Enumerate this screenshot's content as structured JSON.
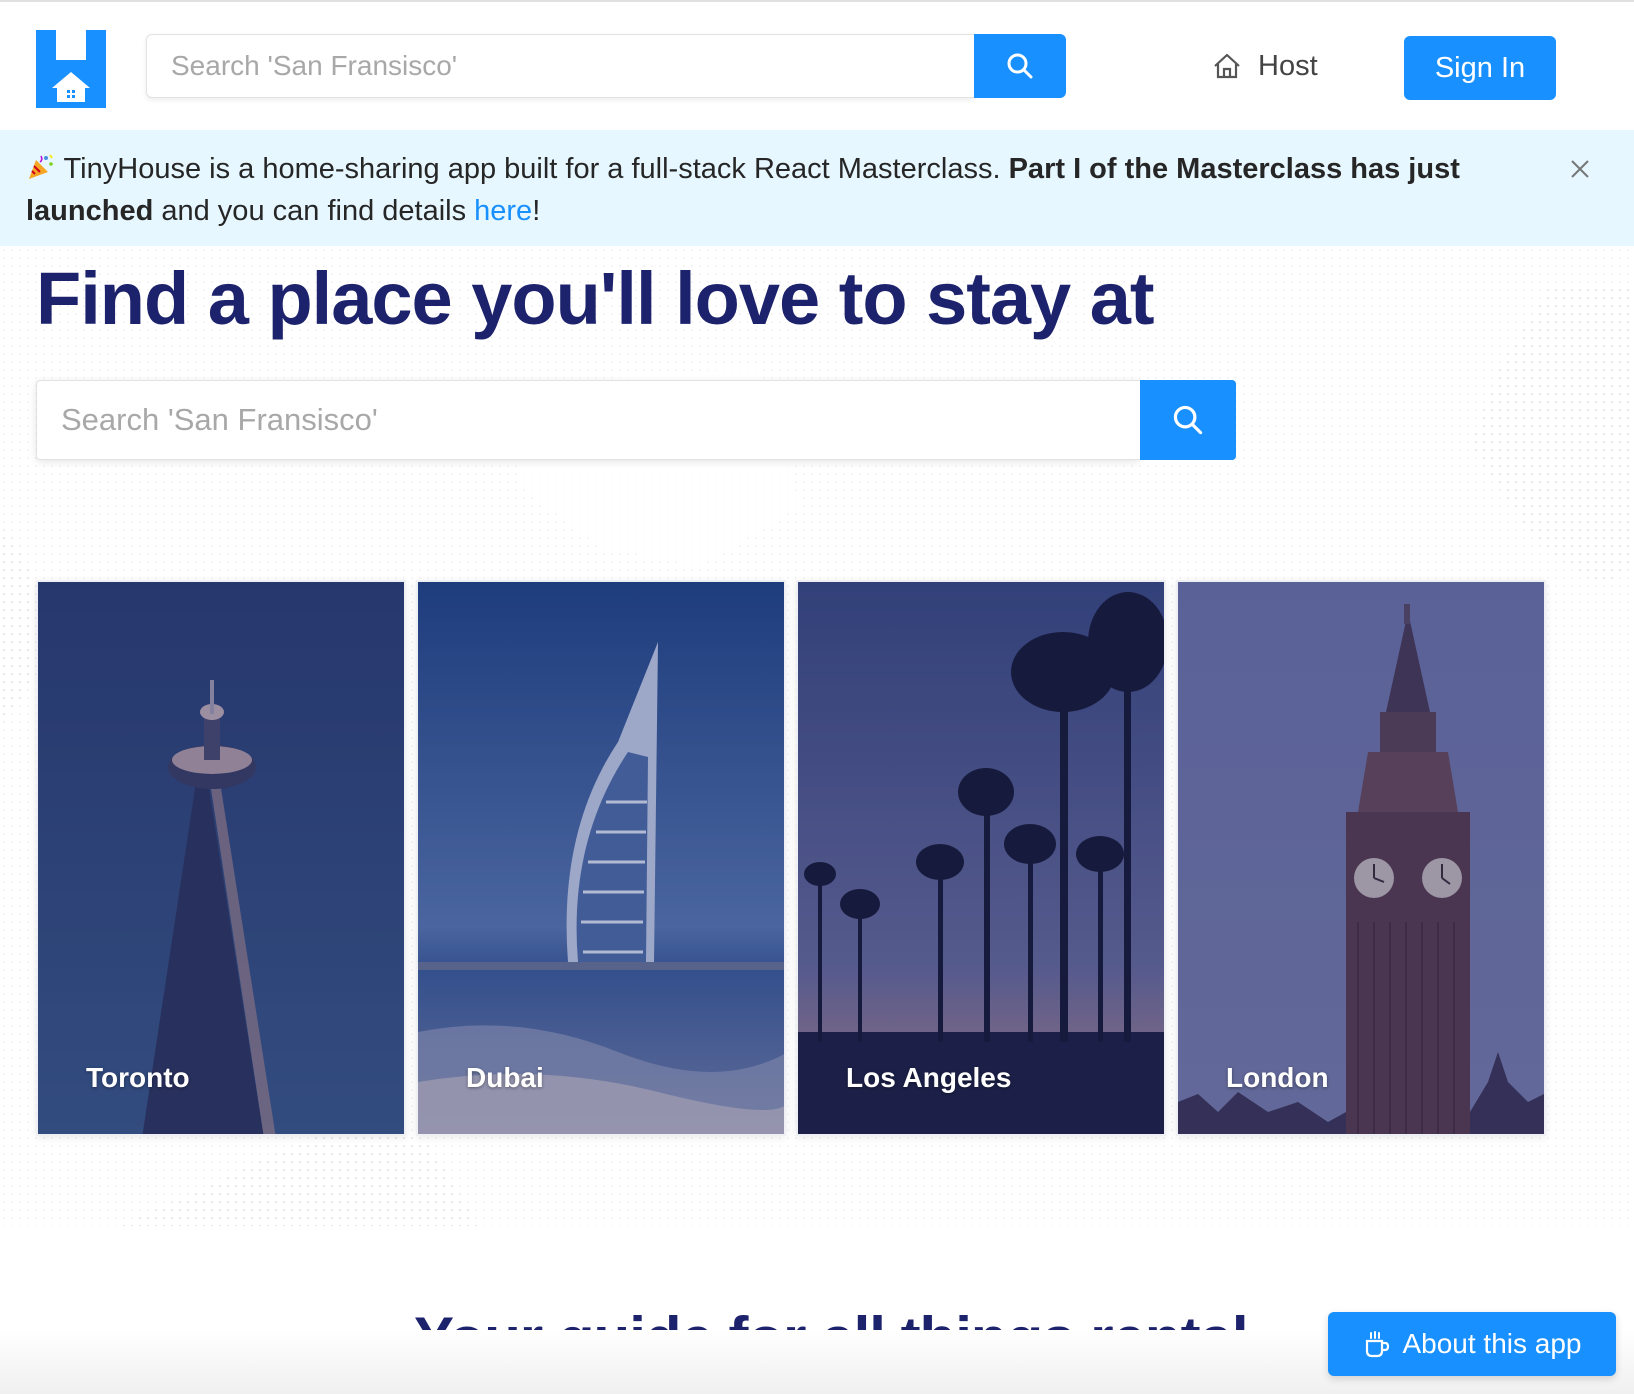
{
  "header": {
    "search": {
      "placeholder": "Search 'San Fransisco'"
    },
    "host_label": "Host",
    "signin_label": "Sign In"
  },
  "banner": {
    "emoji": "party-popper-icon",
    "text_part1": "TinyHouse is a home-sharing app built for a full-stack React Masterclass. ",
    "text_bold": "Part I of the Masterclass has just launched",
    "text_part2": " and you can find details ",
    "link_label": "here",
    "text_end": "!"
  },
  "hero": {
    "title": "Find a place you'll love to stay at",
    "search": {
      "placeholder": "Search 'San Fransisco'"
    },
    "cards": [
      {
        "city": "Toronto"
      },
      {
        "city": "Dubai"
      },
      {
        "city": "Los Angeles"
      },
      {
        "city": "London"
      }
    ]
  },
  "guide": {
    "title": "Your guide for all things rental"
  },
  "about": {
    "label": "About this app"
  },
  "colors": {
    "primary": "#1890ff",
    "heading": "#1d226c",
    "banner_bg": "#e6f7ff"
  }
}
